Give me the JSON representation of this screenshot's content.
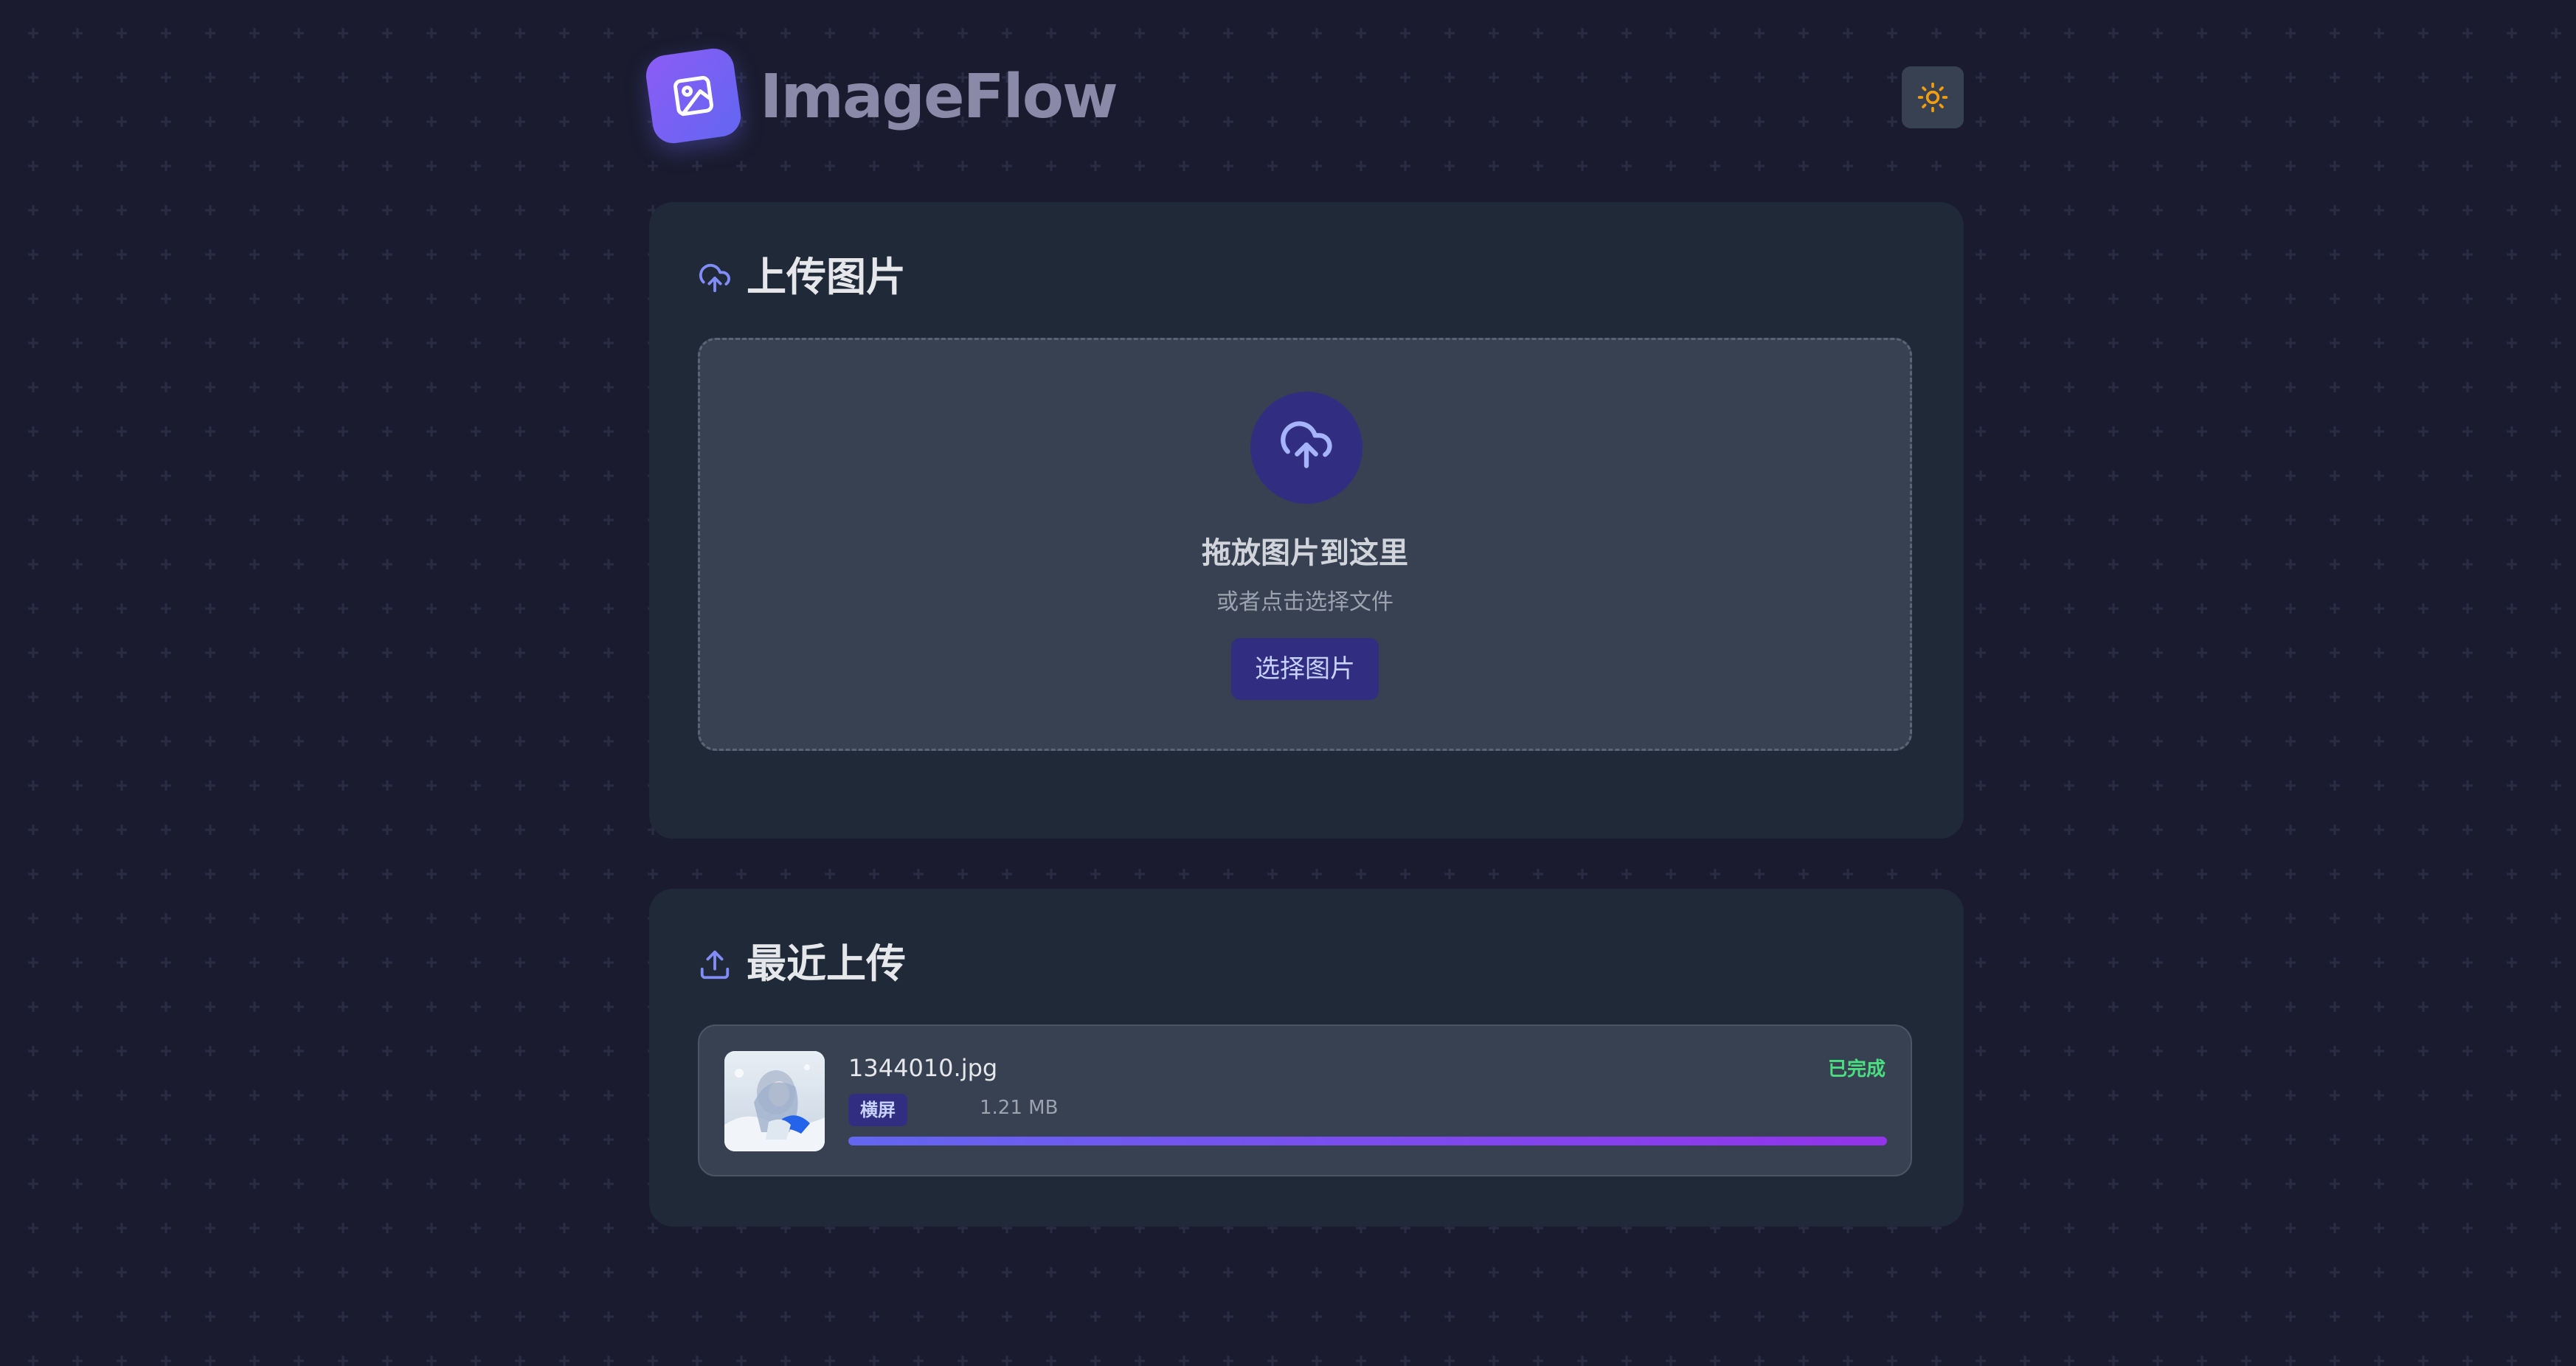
{
  "header": {
    "app_title": "ImageFlow",
    "logo_icon": "image-icon",
    "theme_toggle_icon": "sun-icon"
  },
  "upload_section": {
    "title": "上传图片",
    "title_icon": "cloud-upload-icon",
    "dropzone": {
      "icon": "cloud-upload-icon",
      "title": "拖放图片到这里",
      "subtitle": "或者点击选择文件",
      "button_label": "选择图片"
    }
  },
  "recent_section": {
    "title": "最近上传",
    "title_icon": "upload-icon",
    "items": [
      {
        "file_name": "1344010.jpg",
        "tag": "横屏",
        "size": "1.21 MB",
        "status": "已完成",
        "progress": 1.0
      }
    ]
  },
  "colors": {
    "background": "#1a1b2e",
    "card": "#1f2937",
    "accent": "#6366f1",
    "success": "#4ade80",
    "sun": "#f59e0b"
  }
}
